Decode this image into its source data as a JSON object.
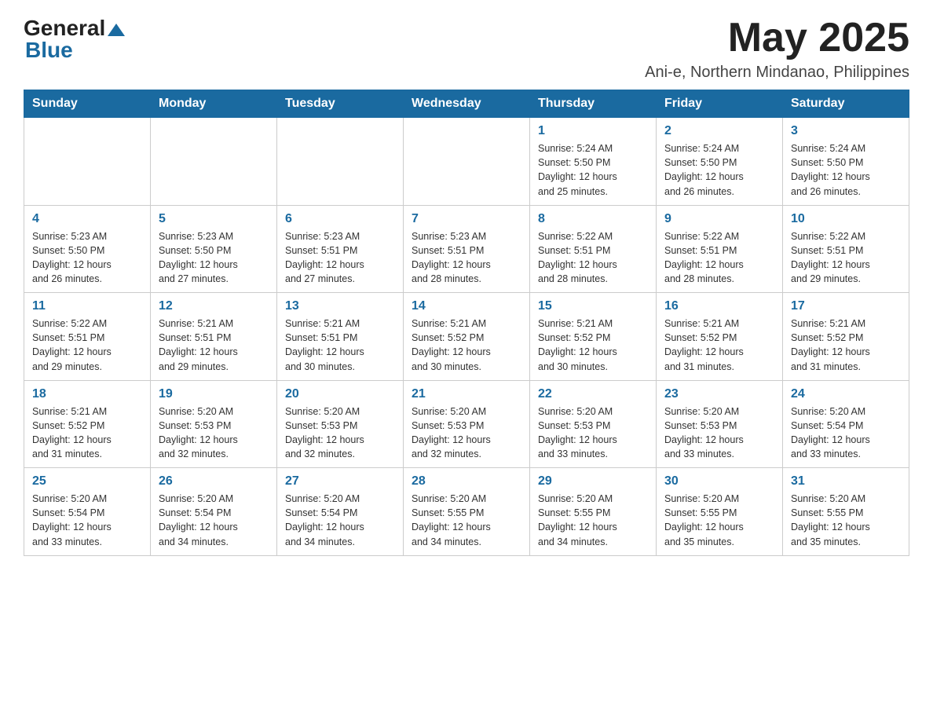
{
  "header": {
    "logo_general": "General",
    "logo_blue": "Blue",
    "month_title": "May 2025",
    "location": "Ani-e, Northern Mindanao, Philippines"
  },
  "days_of_week": [
    "Sunday",
    "Monday",
    "Tuesday",
    "Wednesday",
    "Thursday",
    "Friday",
    "Saturday"
  ],
  "weeks": [
    [
      {
        "day": "",
        "info": ""
      },
      {
        "day": "",
        "info": ""
      },
      {
        "day": "",
        "info": ""
      },
      {
        "day": "",
        "info": ""
      },
      {
        "day": "1",
        "info": "Sunrise: 5:24 AM\nSunset: 5:50 PM\nDaylight: 12 hours\nand 25 minutes."
      },
      {
        "day": "2",
        "info": "Sunrise: 5:24 AM\nSunset: 5:50 PM\nDaylight: 12 hours\nand 26 minutes."
      },
      {
        "day": "3",
        "info": "Sunrise: 5:24 AM\nSunset: 5:50 PM\nDaylight: 12 hours\nand 26 minutes."
      }
    ],
    [
      {
        "day": "4",
        "info": "Sunrise: 5:23 AM\nSunset: 5:50 PM\nDaylight: 12 hours\nand 26 minutes."
      },
      {
        "day": "5",
        "info": "Sunrise: 5:23 AM\nSunset: 5:50 PM\nDaylight: 12 hours\nand 27 minutes."
      },
      {
        "day": "6",
        "info": "Sunrise: 5:23 AM\nSunset: 5:51 PM\nDaylight: 12 hours\nand 27 minutes."
      },
      {
        "day": "7",
        "info": "Sunrise: 5:23 AM\nSunset: 5:51 PM\nDaylight: 12 hours\nand 28 minutes."
      },
      {
        "day": "8",
        "info": "Sunrise: 5:22 AM\nSunset: 5:51 PM\nDaylight: 12 hours\nand 28 minutes."
      },
      {
        "day": "9",
        "info": "Sunrise: 5:22 AM\nSunset: 5:51 PM\nDaylight: 12 hours\nand 28 minutes."
      },
      {
        "day": "10",
        "info": "Sunrise: 5:22 AM\nSunset: 5:51 PM\nDaylight: 12 hours\nand 29 minutes."
      }
    ],
    [
      {
        "day": "11",
        "info": "Sunrise: 5:22 AM\nSunset: 5:51 PM\nDaylight: 12 hours\nand 29 minutes."
      },
      {
        "day": "12",
        "info": "Sunrise: 5:21 AM\nSunset: 5:51 PM\nDaylight: 12 hours\nand 29 minutes."
      },
      {
        "day": "13",
        "info": "Sunrise: 5:21 AM\nSunset: 5:51 PM\nDaylight: 12 hours\nand 30 minutes."
      },
      {
        "day": "14",
        "info": "Sunrise: 5:21 AM\nSunset: 5:52 PM\nDaylight: 12 hours\nand 30 minutes."
      },
      {
        "day": "15",
        "info": "Sunrise: 5:21 AM\nSunset: 5:52 PM\nDaylight: 12 hours\nand 30 minutes."
      },
      {
        "day": "16",
        "info": "Sunrise: 5:21 AM\nSunset: 5:52 PM\nDaylight: 12 hours\nand 31 minutes."
      },
      {
        "day": "17",
        "info": "Sunrise: 5:21 AM\nSunset: 5:52 PM\nDaylight: 12 hours\nand 31 minutes."
      }
    ],
    [
      {
        "day": "18",
        "info": "Sunrise: 5:21 AM\nSunset: 5:52 PM\nDaylight: 12 hours\nand 31 minutes."
      },
      {
        "day": "19",
        "info": "Sunrise: 5:20 AM\nSunset: 5:53 PM\nDaylight: 12 hours\nand 32 minutes."
      },
      {
        "day": "20",
        "info": "Sunrise: 5:20 AM\nSunset: 5:53 PM\nDaylight: 12 hours\nand 32 minutes."
      },
      {
        "day": "21",
        "info": "Sunrise: 5:20 AM\nSunset: 5:53 PM\nDaylight: 12 hours\nand 32 minutes."
      },
      {
        "day": "22",
        "info": "Sunrise: 5:20 AM\nSunset: 5:53 PM\nDaylight: 12 hours\nand 33 minutes."
      },
      {
        "day": "23",
        "info": "Sunrise: 5:20 AM\nSunset: 5:53 PM\nDaylight: 12 hours\nand 33 minutes."
      },
      {
        "day": "24",
        "info": "Sunrise: 5:20 AM\nSunset: 5:54 PM\nDaylight: 12 hours\nand 33 minutes."
      }
    ],
    [
      {
        "day": "25",
        "info": "Sunrise: 5:20 AM\nSunset: 5:54 PM\nDaylight: 12 hours\nand 33 minutes."
      },
      {
        "day": "26",
        "info": "Sunrise: 5:20 AM\nSunset: 5:54 PM\nDaylight: 12 hours\nand 34 minutes."
      },
      {
        "day": "27",
        "info": "Sunrise: 5:20 AM\nSunset: 5:54 PM\nDaylight: 12 hours\nand 34 minutes."
      },
      {
        "day": "28",
        "info": "Sunrise: 5:20 AM\nSunset: 5:55 PM\nDaylight: 12 hours\nand 34 minutes."
      },
      {
        "day": "29",
        "info": "Sunrise: 5:20 AM\nSunset: 5:55 PM\nDaylight: 12 hours\nand 34 minutes."
      },
      {
        "day": "30",
        "info": "Sunrise: 5:20 AM\nSunset: 5:55 PM\nDaylight: 12 hours\nand 35 minutes."
      },
      {
        "day": "31",
        "info": "Sunrise: 5:20 AM\nSunset: 5:55 PM\nDaylight: 12 hours\nand 35 minutes."
      }
    ]
  ]
}
